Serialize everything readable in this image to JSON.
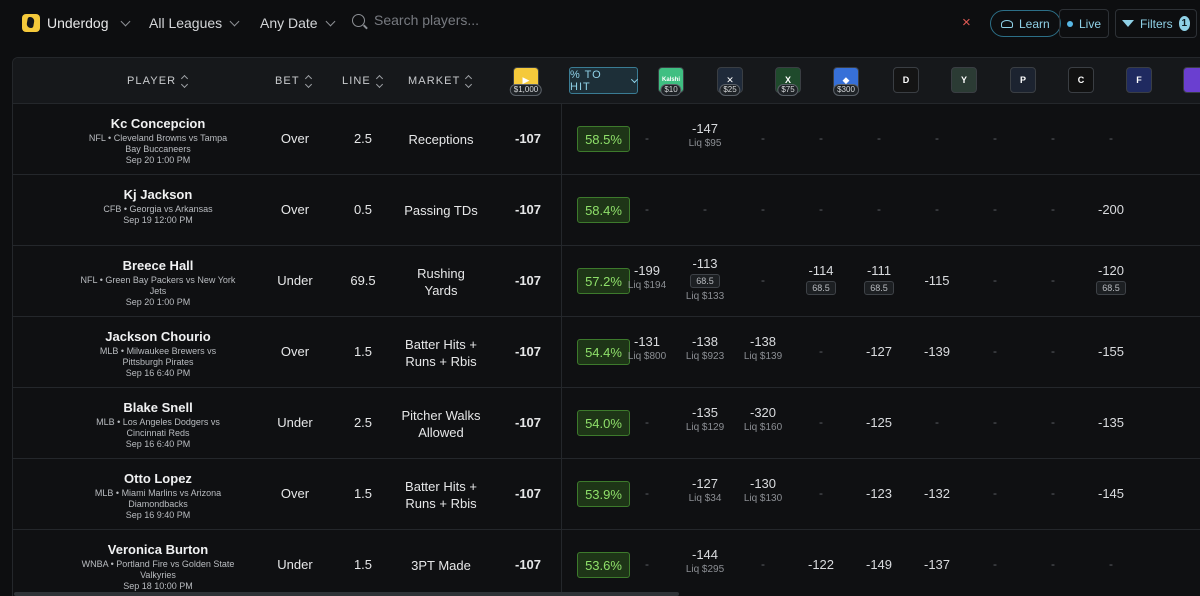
{
  "topbar": {
    "brand": "Underdog",
    "leagues": "All Leagues",
    "date": "Any Date",
    "search_placeholder": "Search players...",
    "clear": "×",
    "learn": "Learn",
    "live": "Live",
    "filters": "Filters",
    "filters_count": "1"
  },
  "columns": {
    "player": "PLAYER",
    "bet": "BET",
    "line": "LINE",
    "market": "MARKET",
    "hit": "% TO HIT"
  },
  "books": [
    {
      "icon": "underdog-book-icon",
      "tag": "$1,000",
      "color": "#f5c93b",
      "glyph": "▶"
    },
    {
      "icon": "kalshi-book-icon",
      "tag": "$10",
      "color": "#3fbf82",
      "glyph": "Kalshi"
    },
    {
      "icon": "sleeper-book-icon",
      "tag": "$25",
      "color": "#1f2a3a",
      "glyph": "✕"
    },
    {
      "icon": "betr-book-icon",
      "tag": "$75",
      "color": "#1f4a2c",
      "glyph": "X"
    },
    {
      "icon": "prizepicks-book-icon",
      "tag": "$300",
      "color": "#3770d8",
      "glyph": "◆"
    },
    {
      "icon": "draftkings-book-icon",
      "tag": "",
      "color": "#141414",
      "glyph": "D"
    },
    {
      "icon": "goblet-book-icon",
      "tag": "",
      "color": "#2b3b34",
      "glyph": "Y"
    },
    {
      "icon": "pinnacle-book-icon",
      "tag": "",
      "color": "#1c2330",
      "glyph": "P"
    },
    {
      "icon": "chalkboard-book-icon",
      "tag": "",
      "color": "#111",
      "glyph": "C"
    },
    {
      "icon": "fliff-book-icon",
      "tag": "",
      "color": "#1f2a60",
      "glyph": "F"
    },
    {
      "icon": "partial-book-icon",
      "tag": "",
      "color": "#6a3fd0",
      "glyph": ""
    }
  ],
  "rows": [
    {
      "name": "Kc Concepcion",
      "game1": "NFL • Cleveland Browns vs Tampa",
      "game2": "Bay Buccaneers",
      "time": "Sep 20 1:00 PM",
      "bet": "Over",
      "line": "2.5",
      "market1": "Receptions",
      "market2": "",
      "price": "-107",
      "hit": "58.5%",
      "odds": [
        {
          "v": "-",
          "liq": "",
          "alt": ""
        },
        {
          "v": "-147",
          "liq": "Liq $95",
          "alt": ""
        },
        {
          "v": "-",
          "liq": "",
          "alt": ""
        },
        {
          "v": "-",
          "liq": "",
          "alt": ""
        },
        {
          "v": "-",
          "liq": "",
          "alt": ""
        },
        {
          "v": "-",
          "liq": "",
          "alt": ""
        },
        {
          "v": "-",
          "liq": "",
          "alt": ""
        },
        {
          "v": "-",
          "liq": "",
          "alt": ""
        },
        {
          "v": "-",
          "liq": "",
          "alt": ""
        }
      ]
    },
    {
      "name": "Kj Jackson",
      "game1": "CFB • Georgia vs Arkansas",
      "game2": "",
      "time": "Sep 19 12:00 PM",
      "bet": "Over",
      "line": "0.5",
      "market1": "Passing TDs",
      "market2": "",
      "price": "-107",
      "hit": "58.4%",
      "odds": [
        {
          "v": "-",
          "liq": "",
          "alt": ""
        },
        {
          "v": "-",
          "liq": "",
          "alt": ""
        },
        {
          "v": "-",
          "liq": "",
          "alt": ""
        },
        {
          "v": "-",
          "liq": "",
          "alt": ""
        },
        {
          "v": "-",
          "liq": "",
          "alt": ""
        },
        {
          "v": "-",
          "liq": "",
          "alt": ""
        },
        {
          "v": "-",
          "liq": "",
          "alt": ""
        },
        {
          "v": "-",
          "liq": "",
          "alt": ""
        },
        {
          "v": "-200",
          "liq": "",
          "alt": ""
        }
      ]
    },
    {
      "name": "Breece Hall",
      "game1": "NFL • Green Bay Packers vs New York",
      "game2": "Jets",
      "time": "Sep 20 1:00 PM",
      "bet": "Under",
      "line": "69.5",
      "market1": "Rushing",
      "market2": "Yards",
      "price": "-107",
      "hit": "57.2%",
      "odds": [
        {
          "v": "-199",
          "liq": "Liq $194",
          "alt": ""
        },
        {
          "v": "-113",
          "liq": "Liq $133",
          "alt": "68.5"
        },
        {
          "v": "-",
          "liq": "",
          "alt": ""
        },
        {
          "v": "-114",
          "liq": "",
          "alt": "68.5"
        },
        {
          "v": "-111",
          "liq": "",
          "alt": "68.5"
        },
        {
          "v": "-115",
          "liq": "",
          "alt": ""
        },
        {
          "v": "-",
          "liq": "",
          "alt": ""
        },
        {
          "v": "-",
          "liq": "",
          "alt": ""
        },
        {
          "v": "-120",
          "liq": "",
          "alt": "68.5"
        }
      ]
    },
    {
      "name": "Jackson Chourio",
      "game1": "MLB • Milwaukee Brewers vs",
      "game2": "Pittsburgh Pirates",
      "time": "Sep 16 6:40 PM",
      "bet": "Over",
      "line": "1.5",
      "market1": "Batter Hits +",
      "market2": "Runs + Rbis",
      "price": "-107",
      "hit": "54.4%",
      "odds": [
        {
          "v": "-131",
          "liq": "Liq $800",
          "alt": ""
        },
        {
          "v": "-138",
          "liq": "Liq $923",
          "alt": ""
        },
        {
          "v": "-138",
          "liq": "Liq $139",
          "alt": ""
        },
        {
          "v": "-",
          "liq": "",
          "alt": ""
        },
        {
          "v": "-127",
          "liq": "",
          "alt": ""
        },
        {
          "v": "-139",
          "liq": "",
          "alt": ""
        },
        {
          "v": "-",
          "liq": "",
          "alt": ""
        },
        {
          "v": "-",
          "liq": "",
          "alt": ""
        },
        {
          "v": "-155",
          "liq": "",
          "alt": ""
        }
      ]
    },
    {
      "name": "Blake Snell",
      "game1": "MLB • Los Angeles Dodgers vs",
      "game2": "Cincinnati Reds",
      "time": "Sep 16 6:40 PM",
      "bet": "Under",
      "line": "2.5",
      "market1": "Pitcher Walks",
      "market2": "Allowed",
      "price": "-107",
      "hit": "54.0%",
      "odds": [
        {
          "v": "-",
          "liq": "",
          "alt": ""
        },
        {
          "v": "-135",
          "liq": "Liq $129",
          "alt": ""
        },
        {
          "v": "-320",
          "liq": "Liq $160",
          "alt": ""
        },
        {
          "v": "-",
          "liq": "",
          "alt": ""
        },
        {
          "v": "-125",
          "liq": "",
          "alt": ""
        },
        {
          "v": "-",
          "liq": "",
          "alt": ""
        },
        {
          "v": "-",
          "liq": "",
          "alt": ""
        },
        {
          "v": "-",
          "liq": "",
          "alt": ""
        },
        {
          "v": "-135",
          "liq": "",
          "alt": ""
        }
      ]
    },
    {
      "name": "Otto Lopez",
      "game1": "MLB • Miami Marlins vs Arizona",
      "game2": "Diamondbacks",
      "time": "Sep 16 9:40 PM",
      "bet": "Over",
      "line": "1.5",
      "market1": "Batter Hits +",
      "market2": "Runs + Rbis",
      "price": "-107",
      "hit": "53.9%",
      "odds": [
        {
          "v": "-",
          "liq": "",
          "alt": ""
        },
        {
          "v": "-127",
          "liq": "Liq $34",
          "alt": ""
        },
        {
          "v": "-130",
          "liq": "Liq $130",
          "alt": ""
        },
        {
          "v": "-",
          "liq": "",
          "alt": ""
        },
        {
          "v": "-123",
          "liq": "",
          "alt": ""
        },
        {
          "v": "-132",
          "liq": "",
          "alt": ""
        },
        {
          "v": "-",
          "liq": "",
          "alt": ""
        },
        {
          "v": "-",
          "liq": "",
          "alt": ""
        },
        {
          "v": "-145",
          "liq": "",
          "alt": ""
        }
      ]
    },
    {
      "name": "Veronica Burton",
      "game1": "WNBA • Portland Fire vs Golden State",
      "game2": "Valkyries",
      "time": "Sep 18 10:00 PM",
      "bet": "Under",
      "line": "1.5",
      "market1": "3PT Made",
      "market2": "",
      "price": "-107",
      "hit": "53.6%",
      "odds": [
        {
          "v": "-",
          "liq": "",
          "alt": ""
        },
        {
          "v": "-144",
          "liq": "Liq $295",
          "alt": ""
        },
        {
          "v": "-",
          "liq": "",
          "alt": ""
        },
        {
          "v": "-122",
          "liq": "",
          "alt": ""
        },
        {
          "v": "-149",
          "liq": "",
          "alt": ""
        },
        {
          "v": "-137",
          "liq": "",
          "alt": ""
        },
        {
          "v": "-",
          "liq": "",
          "alt": ""
        },
        {
          "v": "-",
          "liq": "",
          "alt": ""
        },
        {
          "v": "-",
          "liq": "",
          "alt": ""
        }
      ]
    }
  ]
}
